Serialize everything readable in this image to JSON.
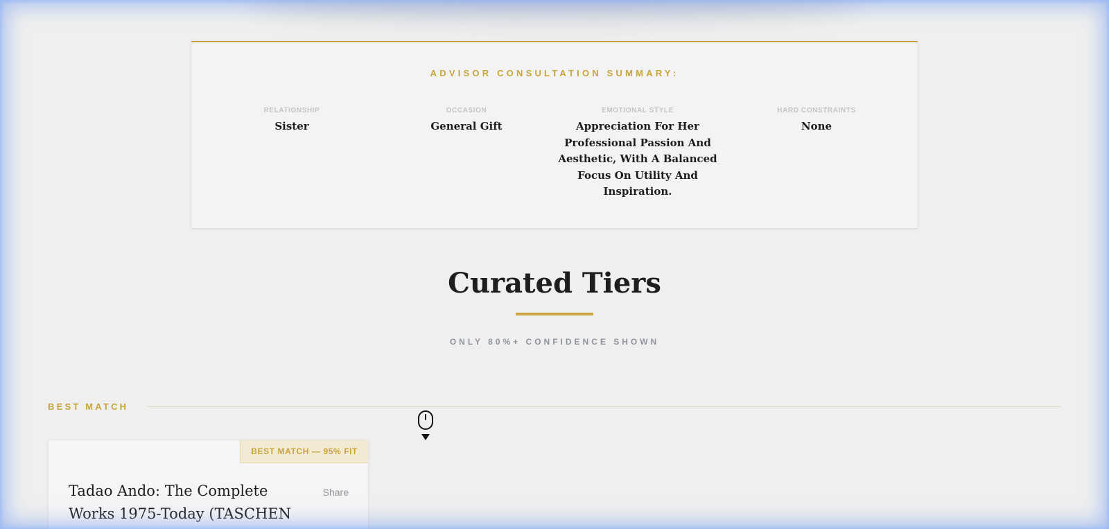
{
  "summary": {
    "title": "ADVISOR CONSULTATION SUMMARY:",
    "fields": [
      {
        "label": "RELATIONSHIP",
        "value": "Sister"
      },
      {
        "label": "OCCASION",
        "value": "General Gift"
      },
      {
        "label": "EMOTIONAL STYLE",
        "value": "Appreciation For Her Professional Passion And Aesthetic, With A Balanced Focus On Utility And Inspiration."
      },
      {
        "label": "HARD CONSTRAINTS",
        "value": "None"
      }
    ]
  },
  "tiers": {
    "title": "Curated Tiers",
    "subtitle": "ONLY 80%+ CONFIDENCE SHOWN"
  },
  "best_match": {
    "section_label": "BEST MATCH",
    "badge": "BEST MATCH — 95% FIT",
    "product_title": "Tadao Ando: The Complete Works 1975-Today (TASCHEN",
    "share_label": "Share"
  },
  "colors": {
    "accent": "#c9a43a",
    "background": "#efefef",
    "muted_text": "#8f939b"
  },
  "icons": {
    "scroll_hint": "mouse-scroll-icon"
  }
}
